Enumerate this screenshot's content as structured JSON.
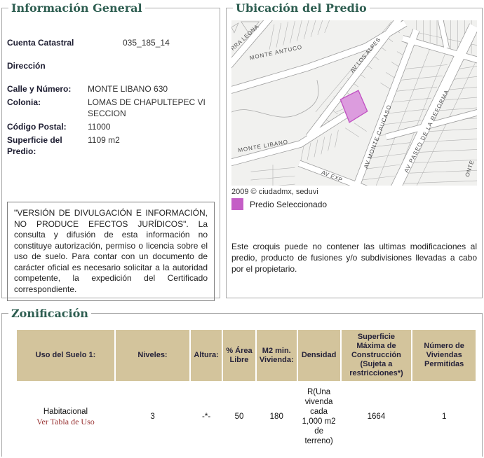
{
  "colors": {
    "section_title_green": "#2e5e51",
    "table_header_bg": "#d3c49c",
    "selected_parcel": "#c45ec6",
    "link_maroon": "#993333"
  },
  "general": {
    "title": "Información General",
    "cuenta_label": "Cuenta Catastral",
    "cuenta_value": "035_185_14",
    "direccion_label": "Dirección",
    "calle_label": "Calle y Número:",
    "calle_value": "MONTE LIBANO 630",
    "colonia_label": "Colonia:",
    "colonia_value": "LOMAS DE CHAPULTEPEC VI SECCION",
    "cp_label": "Código Postal:",
    "cp_value": "11000",
    "superficie_label": "Superficie del Predio:",
    "superficie_value": "1109 m2",
    "disclaimer": "\"VERSIÓN DE DIVULGACIÓN E INFORMACIÓN, NO PRODUCE EFECTOS JURÍDICOS\". La consulta y difusión de esta información no constituye autorización, permiso o licencia sobre el uso de suelo. Para contar con un documento de carácter oficial es necesario solicitar a la autoridad competente, la expedición del Certificado correspondiente."
  },
  "location": {
    "title": "Ubicación del Predio",
    "streets": {
      "sierra_leona": "RRA LEONA",
      "monte_antuco": "MONTE ANTUCO",
      "av_los_alpes": "AV LOS ALPES",
      "av_monte_caucaso": "AV MONTE CAUCASO",
      "av_paseo_reforma": "AV PASEO DE LA REFORMA",
      "monte_libano": "MONTE LIBANO",
      "av_exp": "AV EXP",
      "partial_right": "ONTE"
    },
    "attribution": "2009 © ciudadmx, seduvi",
    "legend_label": "Predio Seleccionado",
    "note": "Este croquis puede no contener las ultimas modificaciones al predio, producto de fusiones y/o subdivisiones llevadas a cabo por el propietario."
  },
  "zoning": {
    "title": "Zonificación",
    "headers": [
      "Uso del Suelo 1:",
      "Niveles:",
      "Altura:",
      "% Área Libre",
      "M2 min. Vivienda:",
      "Densidad",
      "Superficie Máxima de Construcción (Sujeta a restricciones*)",
      "Número de Viviendas Permitidas"
    ],
    "row": {
      "uso": "Habitacional",
      "uso_link": "Ver Tabla de Uso",
      "niveles": "3",
      "altura": "-*-",
      "area_libre": "50",
      "m2_min": "180",
      "densidad": "R(Una vivenda cada 1,000 m2 de terreno)",
      "superficie": "1664",
      "viviendas": "1"
    }
  }
}
